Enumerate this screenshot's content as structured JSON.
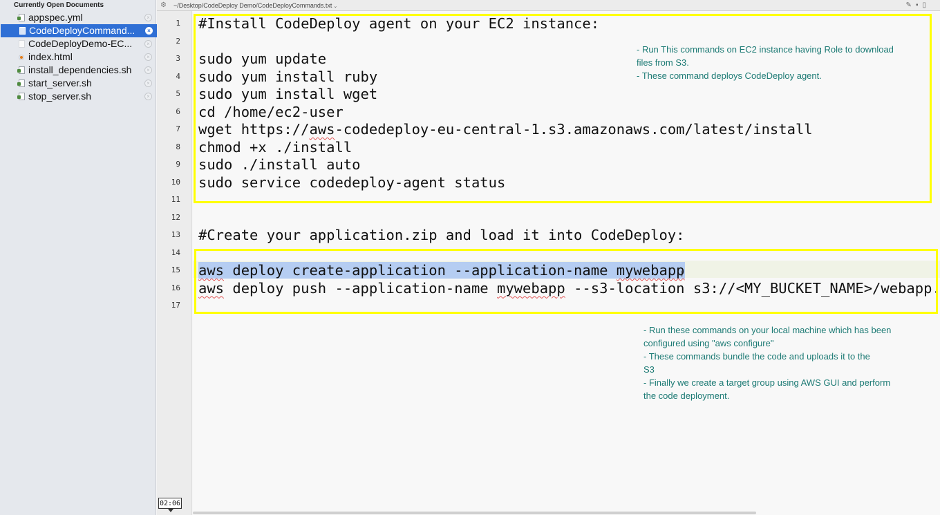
{
  "sidebar": {
    "header": "Currently Open Documents",
    "files": [
      {
        "label": "appspec.yml",
        "icon": "script-file-icon",
        "selected": false
      },
      {
        "label": "CodeDeployCommand...",
        "icon": "document-file-icon",
        "selected": true
      },
      {
        "label": "CodeDeployDemo-EC...",
        "icon": "blank-file-icon",
        "selected": false
      },
      {
        "label": "index.html",
        "icon": "html-file-icon",
        "selected": false
      },
      {
        "label": "install_dependencies.sh",
        "icon": "script-file-icon",
        "selected": false
      },
      {
        "label": "start_server.sh",
        "icon": "script-file-icon",
        "selected": false
      },
      {
        "label": "stop_server.sh",
        "icon": "script-file-icon",
        "selected": false
      }
    ]
  },
  "pathbar": {
    "path": "~/Desktop/CodeDeploy Demo/CodeDeployCommands.txt",
    "caret": "⌄"
  },
  "gutter": {
    "line_numbers": [
      "1",
      "2",
      "3",
      "4",
      "5",
      "6",
      "7",
      "8",
      "9",
      "10",
      "11",
      "12",
      "13",
      "14",
      "15",
      "16",
      "17"
    ],
    "timestamp": "02:06"
  },
  "code": {
    "lines": [
      "#Install CodeDeploy agent on your EC2 instance:",
      "",
      "sudo yum update",
      "sudo yum install ruby",
      "sudo yum install wget",
      "cd /home/ec2-user",
      "wget https://aws-codedeploy-eu-central-1.s3.amazonaws.com/latest/install",
      "chmod +x ./install",
      "sudo ./install auto",
      "sudo service codedeploy-agent status",
      "",
      "",
      "#Create your application.zip and load it into CodeDeploy:",
      "",
      "aws deploy create-application --application-name mywebapp",
      "aws deploy push --application-name mywebapp --s3-location s3://<MY_BUCKET_NAME>/webapp.",
      ""
    ],
    "line7_parts": [
      "wget https://",
      "aws",
      "-codedeploy-eu-central-1.s3.amazonaws.com/latest/install"
    ],
    "line15_parts": [
      "aws",
      " deploy create-application --application-name ",
      "mywebapp"
    ],
    "line16_parts": [
      "aws",
      " deploy push --application-name ",
      "mywebapp",
      " --s3-location s3://<MY_BUCKET_NAME>/webapp."
    ],
    "selected_line": 15
  },
  "notes": {
    "note1": [
      "- Run This commands on EC2 instance having Role to download",
      "files from S3.",
      "- These command deploys CodeDeploy agent."
    ],
    "note2": [
      "- Run these commands on your local machine which has been",
      "configured using \"aws configure\"",
      "- These commands bundle the code and uploads it to the",
      "S3",
      "- Finally we create a target group using AWS GUI and perform",
      "the code deployment."
    ]
  },
  "colors": {
    "highlight_box": "#ffff00",
    "note_text": "#1c7a74",
    "selection": "#b5cdf2",
    "sidebar_selected": "#2f6fd5"
  }
}
